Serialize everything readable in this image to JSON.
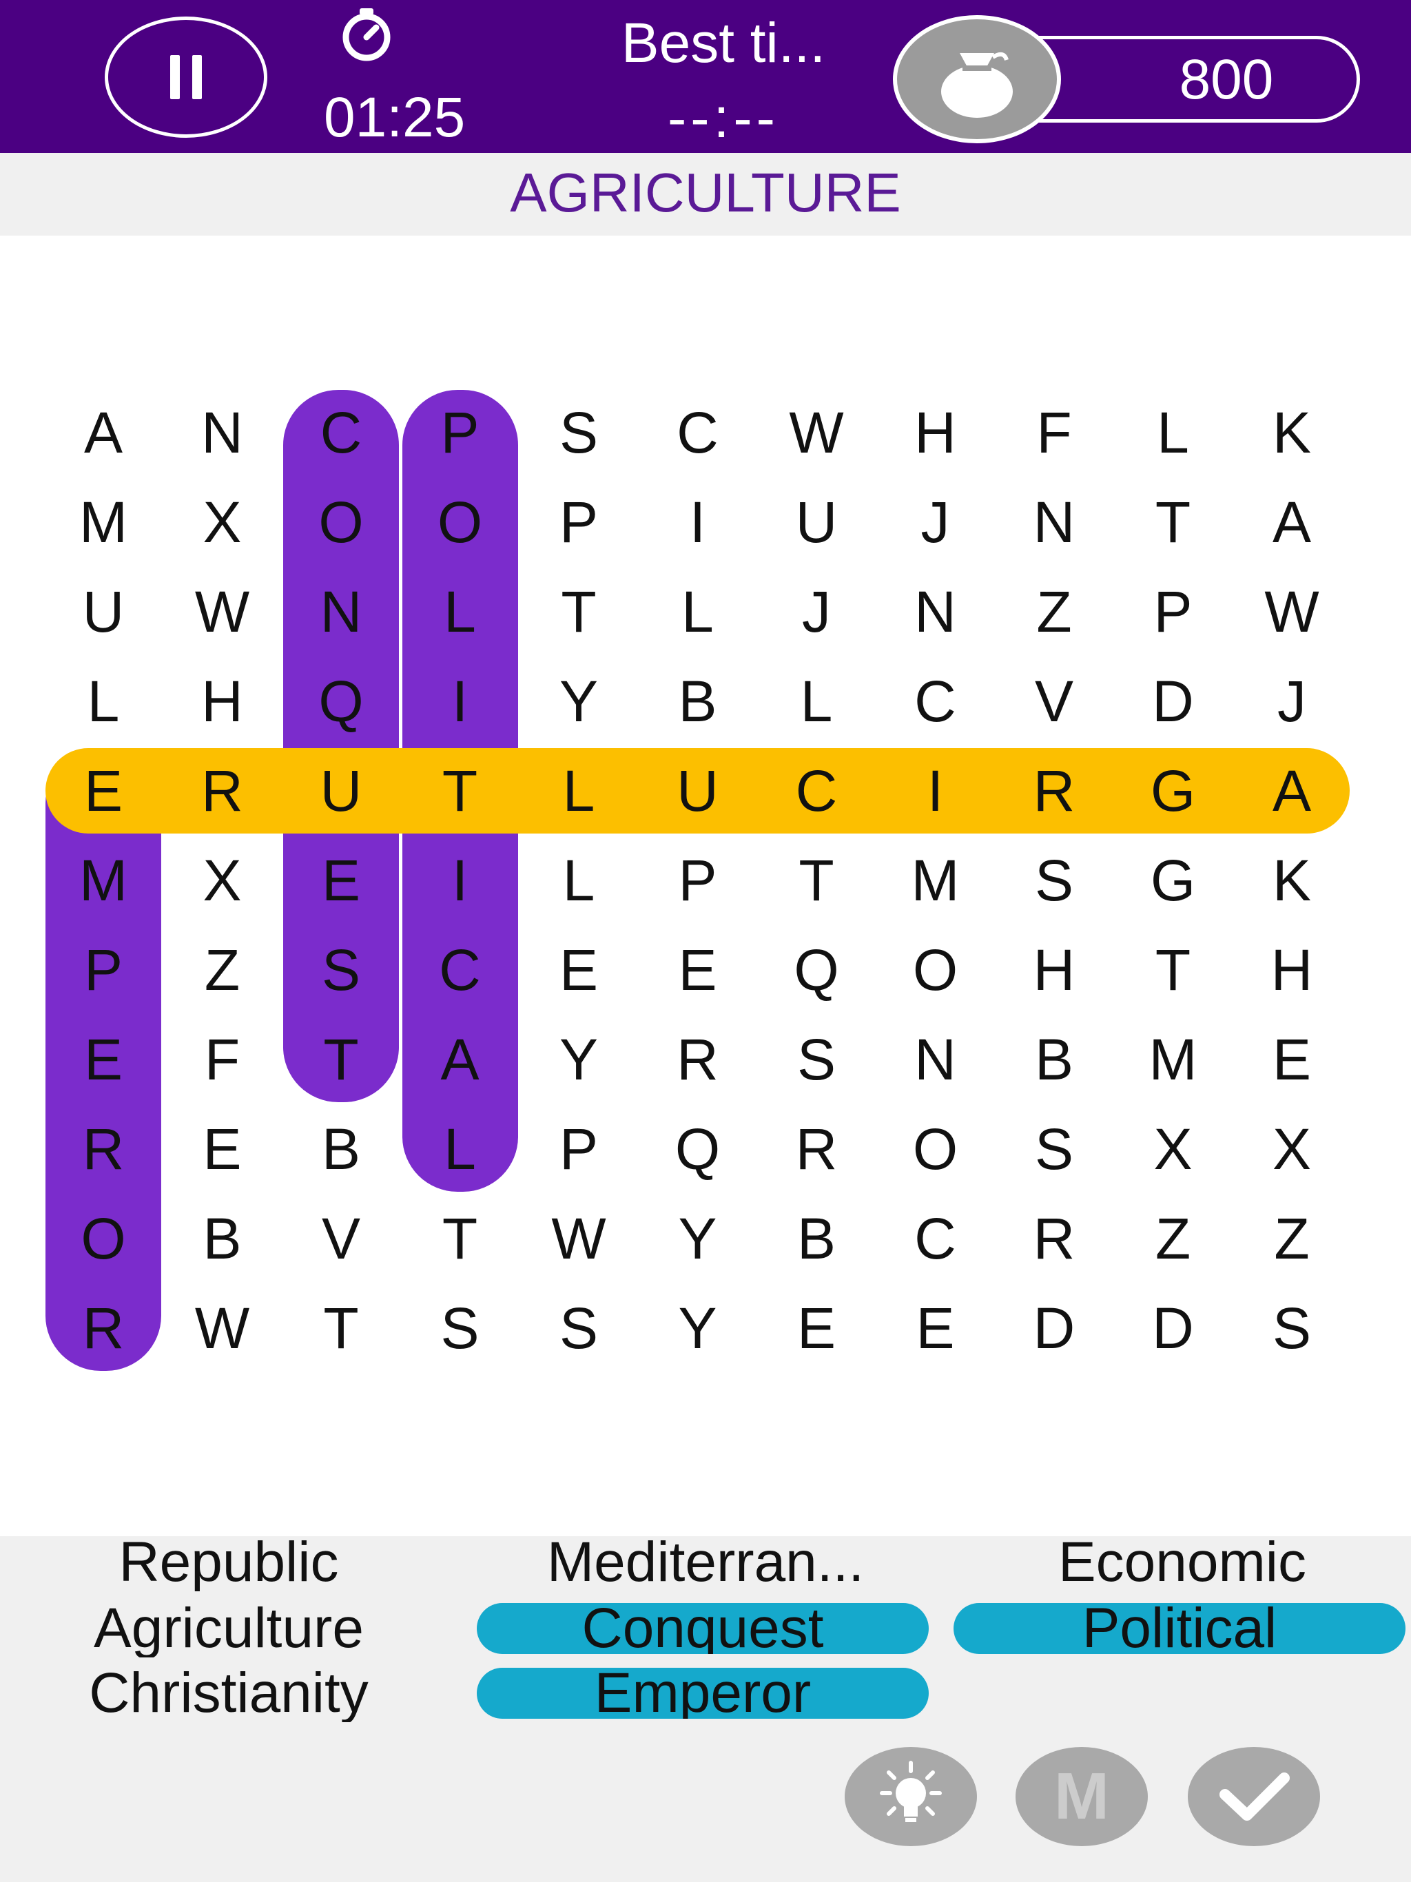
{
  "header": {
    "timer": "01:25",
    "best_label": "Best ti...",
    "best_value": "--:--",
    "coins": "800"
  },
  "category": "AGRICULTURE",
  "grid": [
    [
      "A",
      "N",
      "C",
      "P",
      "S",
      "C",
      "W",
      "H",
      "F",
      "L",
      "K"
    ],
    [
      "M",
      "X",
      "O",
      "O",
      "P",
      "I",
      "U",
      "J",
      "N",
      "T",
      "A"
    ],
    [
      "U",
      "W",
      "N",
      "L",
      "T",
      "L",
      "J",
      "N",
      "Z",
      "P",
      "W"
    ],
    [
      "L",
      "H",
      "Q",
      "I",
      "Y",
      "B",
      "L",
      "C",
      "V",
      "D",
      "J"
    ],
    [
      "E",
      "R",
      "U",
      "T",
      "L",
      "U",
      "C",
      "I",
      "R",
      "G",
      "A"
    ],
    [
      "M",
      "X",
      "E",
      "I",
      "L",
      "P",
      "T",
      "M",
      "S",
      "G",
      "K"
    ],
    [
      "P",
      "Z",
      "S",
      "C",
      "E",
      "E",
      "Q",
      "O",
      "H",
      "T",
      "H"
    ],
    [
      "E",
      "F",
      "T",
      "A",
      "Y",
      "R",
      "S",
      "N",
      "B",
      "M",
      "E"
    ],
    [
      "R",
      "E",
      "B",
      "L",
      "P",
      "Q",
      "R",
      "O",
      "S",
      "X",
      "X"
    ],
    [
      "O",
      "B",
      "V",
      "T",
      "W",
      "Y",
      "B",
      "C",
      "R",
      "Z",
      "Z"
    ],
    [
      "R",
      "W",
      "T",
      "S",
      "S",
      "Y",
      "E",
      "E",
      "D",
      "D",
      "S"
    ]
  ],
  "highlights": [
    {
      "word": "Conquest",
      "color": "#7b2ccc",
      "from": [
        0,
        2
      ],
      "to": [
        7,
        2
      ]
    },
    {
      "word": "Political",
      "color": "#7b2ccc",
      "from": [
        0,
        3
      ],
      "to": [
        8,
        3
      ]
    },
    {
      "word": "Emperor",
      "color": "#7b2ccc",
      "from": [
        4,
        0
      ],
      "to": [
        10,
        0
      ]
    },
    {
      "word": "Agriculture",
      "color": "#fcbf00",
      "from": [
        4,
        10
      ],
      "to": [
        4,
        0
      ]
    }
  ],
  "words": [
    {
      "label": "Republic",
      "found": false
    },
    {
      "label": "Mediterran...",
      "found": false
    },
    {
      "label": "Economic",
      "found": false
    },
    {
      "label": "Agriculture",
      "found": false
    },
    {
      "label": "Conquest",
      "found": true
    },
    {
      "label": "Political",
      "found": true
    },
    {
      "label": "Christianity",
      "found": false
    },
    {
      "label": "Emperor",
      "found": true
    }
  ],
  "tools": {
    "hint_icon": "lightbulb-icon",
    "magnet_letter": "M",
    "check_icon": "check-icon"
  },
  "colors": {
    "header_bg": "#4b0082",
    "category_text": "#5a1a96",
    "found_word": "#15a9cc",
    "tool_button": "#a9a9a9"
  }
}
